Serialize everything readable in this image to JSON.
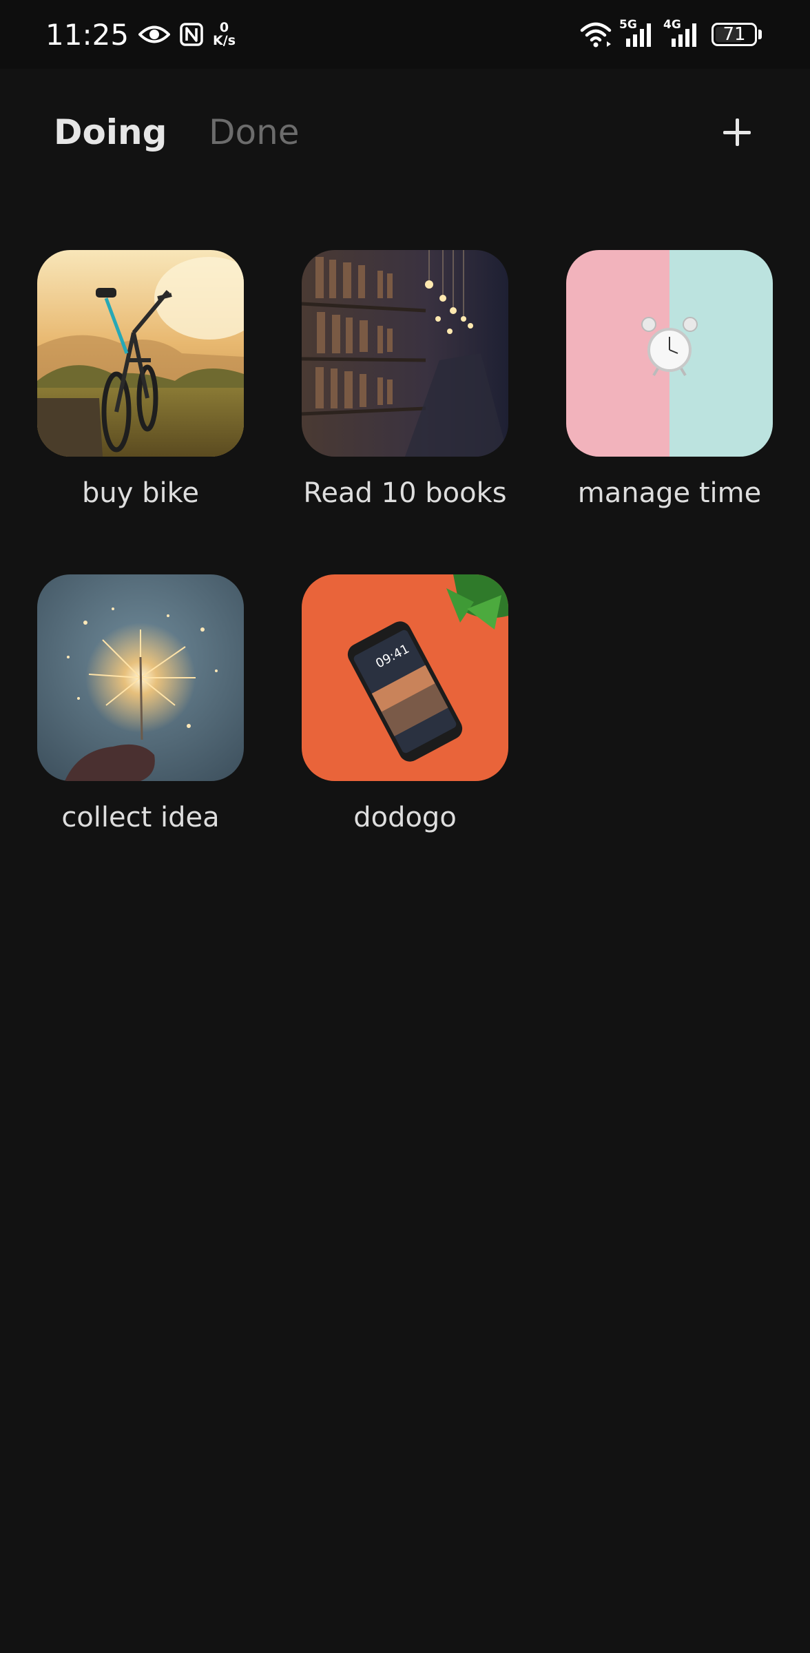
{
  "status_bar": {
    "time": "11:25",
    "net_speed_value": "0",
    "net_speed_unit": "K/s",
    "signal_1_tag": "5G",
    "signal_2_tag": "4G",
    "battery_percent": "71",
    "battery_level": 0.71,
    "icons": [
      "eye-icon",
      "nfc-icon",
      "wifi-icon",
      "signal-5g-icon",
      "signal-4g-icon",
      "battery-icon"
    ]
  },
  "header": {
    "tabs": [
      {
        "label": "Doing",
        "active": true
      },
      {
        "label": "Done",
        "active": false
      }
    ],
    "add_icon": "plus-icon"
  },
  "goals": [
    {
      "label": "buy bike",
      "image": "bike-at-sunset"
    },
    {
      "label": "Read 10 books",
      "image": "library-bookshelves"
    },
    {
      "label": "manage time",
      "image": "alarm-clock-pink-teal"
    },
    {
      "label": "collect idea",
      "image": "sparkler-in-hand"
    },
    {
      "label": "dodogo",
      "image": "phone-on-orange",
      "phone_time": "09:41"
    }
  ],
  "colors": {
    "background": "#121212",
    "active_tab": "#e6e6e6",
    "inactive_tab": "#6c6c6c",
    "label": "#dedede"
  }
}
